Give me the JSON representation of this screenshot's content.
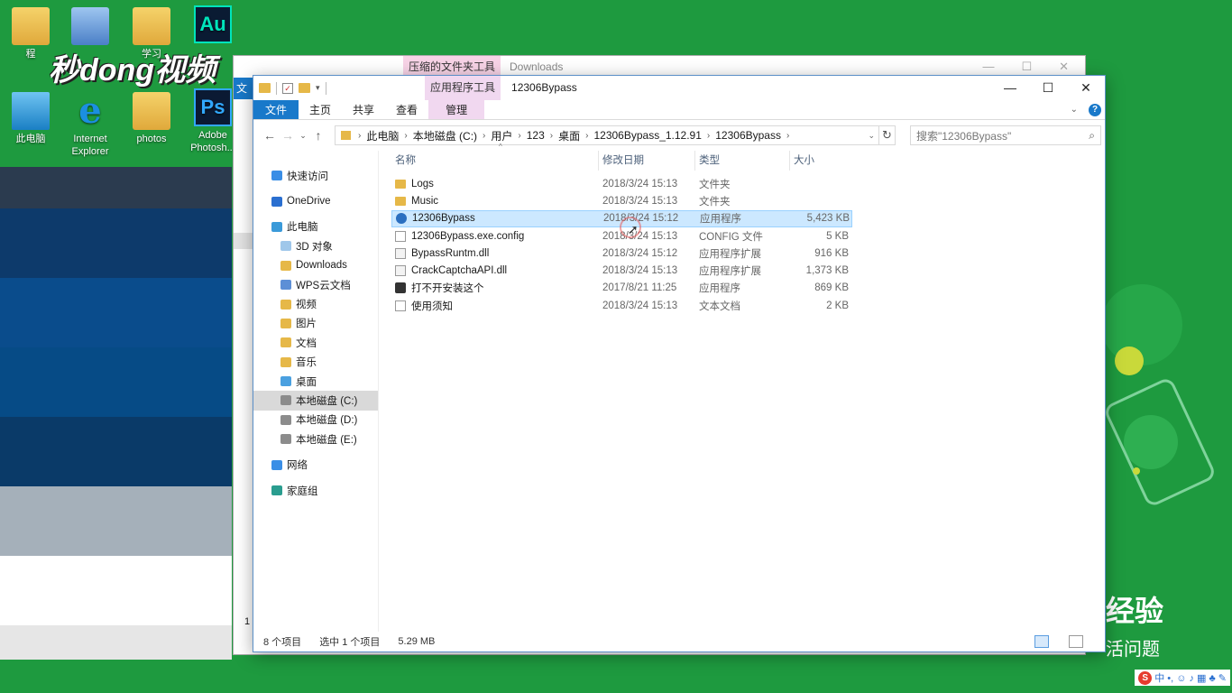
{
  "desktop": {
    "watermark": "秒dong视频",
    "icons": [
      {
        "label": "程"
      },
      {
        "label": ""
      },
      {
        "label": "学习"
      },
      {
        "label": "Au"
      },
      {
        "label": "此电脑"
      },
      {
        "label": "Internet Explorer"
      },
      {
        "label": "photos"
      },
      {
        "label": "Adobe Photosh..."
      },
      {
        "label": "Ps"
      }
    ],
    "bg_text": {
      "line1": "经验",
      "line2": "活问题"
    },
    "left_bands": [
      "#2b3b4f",
      "#0d3a6b",
      "#0a4c8c",
      "#064b86",
      "#0a3a68",
      "#a5b0ba",
      "#ffffff",
      "#e6e6e6"
    ]
  },
  "back_window": {
    "context_tab": "压缩的文件夹工具",
    "title": "Downloads",
    "strip_label": "文",
    "side_number": "1"
  },
  "window": {
    "title": "12306Bypass",
    "context_tab": "应用程序工具",
    "controls": {
      "min": "—",
      "max": "☐",
      "close": "✕"
    },
    "ribbon_tabs": [
      "文件",
      "主页",
      "共享",
      "查看",
      "管理"
    ],
    "help": "?",
    "breadcrumb": [
      "此电脑",
      "本地磁盘 (C:)",
      "用户",
      "123",
      "桌面",
      "12306Bypass_1.12.91",
      "12306Bypass"
    ],
    "search_placeholder": "搜索\"12306Bypass\"",
    "nav_pane": [
      {
        "label": "快速访问",
        "level": 1,
        "icon": "star-icon",
        "color": "#3a8ee6"
      },
      {
        "label": "OneDrive",
        "level": 1,
        "icon": "cloud-icon",
        "color": "#2a6fd0"
      },
      {
        "label": "此电脑",
        "level": 1,
        "icon": "computer-icon",
        "color": "#3a9ad9"
      },
      {
        "label": "3D 对象",
        "level": 2,
        "icon": "cube-icon",
        "color": "#9fc7ea"
      },
      {
        "label": "Downloads",
        "level": 2,
        "icon": "download-folder-icon",
        "color": "#e6b848"
      },
      {
        "label": "WPS云文档",
        "level": 2,
        "icon": "wps-cloud-icon",
        "color": "#5d8fd6"
      },
      {
        "label": "视频",
        "level": 2,
        "icon": "video-folder-icon",
        "color": "#e6b848"
      },
      {
        "label": "图片",
        "level": 2,
        "icon": "pictures-folder-icon",
        "color": "#e6b848"
      },
      {
        "label": "文档",
        "level": 2,
        "icon": "documents-folder-icon",
        "color": "#e6b848"
      },
      {
        "label": "音乐",
        "level": 2,
        "icon": "music-folder-icon",
        "color": "#e6b848"
      },
      {
        "label": "桌面",
        "level": 2,
        "icon": "desktop-folder-icon",
        "color": "#4aa0e0"
      },
      {
        "label": "本地磁盘 (C:)",
        "level": 2,
        "icon": "drive-icon",
        "color": "#8c8c8c",
        "selected": true
      },
      {
        "label": "本地磁盘 (D:)",
        "level": 2,
        "icon": "drive-icon",
        "color": "#8c8c8c"
      },
      {
        "label": "本地磁盘 (E:)",
        "level": 2,
        "icon": "drive-icon",
        "color": "#8c8c8c"
      },
      {
        "label": "网络",
        "level": 1,
        "icon": "network-icon",
        "color": "#3a8ee6"
      },
      {
        "label": "家庭组",
        "level": 1,
        "icon": "homegroup-icon",
        "color": "#2a9d8f"
      }
    ],
    "columns": {
      "name": "名称",
      "date": "修改日期",
      "type": "类型",
      "size": "大小"
    },
    "sort_indicator": "^",
    "files": [
      {
        "name": "Logs",
        "date": "2018/3/24 15:13",
        "type": "文件夹",
        "size": "",
        "icon": "folder"
      },
      {
        "name": "Music",
        "date": "2018/3/24 15:13",
        "type": "文件夹",
        "size": "",
        "icon": "folder"
      },
      {
        "name": "12306Bypass",
        "date": "2018/3/24 15:12",
        "type": "应用程序",
        "size": "5,423 KB",
        "icon": "exe",
        "selected": true
      },
      {
        "name": "12306Bypass.exe.config",
        "date": "2018/3/24 15:13",
        "type": "CONFIG 文件",
        "size": "5 KB",
        "icon": "doc"
      },
      {
        "name": "BypassRuntm.dll",
        "date": "2018/3/24 15:12",
        "type": "应用程序扩展",
        "size": "916 KB",
        "icon": "dll"
      },
      {
        "name": "CrackCaptchaAPI.dll",
        "date": "2018/3/24 15:13",
        "type": "应用程序扩展",
        "size": "1,373 KB",
        "icon": "dll"
      },
      {
        "name": "打不开安装这个",
        "date": "2017/8/21 11:25",
        "type": "应用程序",
        "size": "869 KB",
        "icon": "inst"
      },
      {
        "name": "使用须知",
        "date": "2018/3/24 15:13",
        "type": "文本文档",
        "size": "2 KB",
        "icon": "doc"
      }
    ],
    "status": {
      "count": "8 个项目",
      "selected": "选中 1 个项目",
      "size": "5.29 MB"
    }
  },
  "tray": {
    "ime": "S",
    "lang": "中",
    "glyphs": "•, ☺ ♪ ▦ ♣ ✎"
  }
}
